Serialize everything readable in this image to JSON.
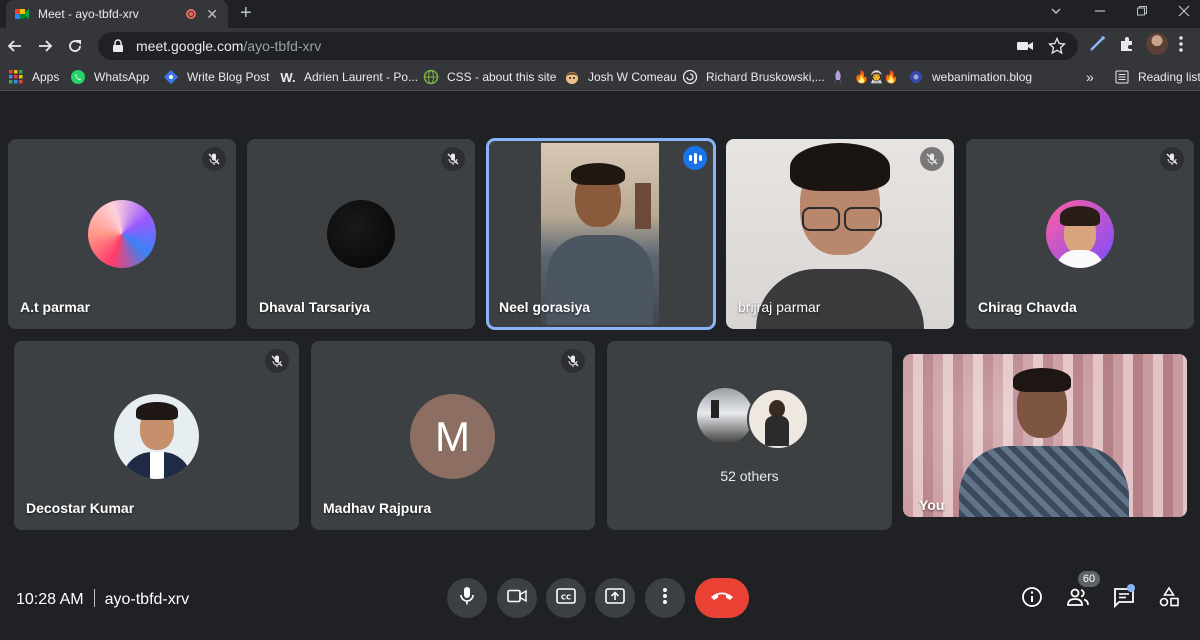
{
  "browser": {
    "tab_title": "Meet - ayo-tbfd-xrv",
    "url_host": "meet.google.com",
    "url_path": "/ayo-tbfd-xrv",
    "bookmarks": [
      {
        "label": "Apps",
        "icon": "apps-grid-icon"
      },
      {
        "label": "WhatsApp",
        "icon": "whatsapp-icon"
      },
      {
        "label": "Write Blog Post",
        "icon": "blog-icon"
      },
      {
        "label": "Adrien Laurent - Po...",
        "icon": "w-logo-icon"
      },
      {
        "label": "CSS - about this site",
        "icon": "css-globe-icon"
      },
      {
        "label": "Josh W Comeau",
        "icon": "josh-avatar-icon"
      },
      {
        "label": "Richard Bruskowski,...",
        "icon": "spiral-icon"
      },
      {
        "label": "🔥👨‍🚀🔥",
        "icon": "rocket-icon"
      },
      {
        "label": "webanimation.blog",
        "icon": "webanimation-icon"
      }
    ],
    "more_bookmarks": "»",
    "reading_list": "Reading list"
  },
  "meet": {
    "participants_row1": [
      {
        "name": "A.t parmar",
        "status": "muted"
      },
      {
        "name": "Dhaval Tarsariya",
        "status": "muted"
      },
      {
        "name": "Neel gorasiya",
        "status": "speaking"
      },
      {
        "name": "brijraj parmar",
        "status": "muted"
      },
      {
        "name": "Chirag Chavda",
        "status": "muted"
      }
    ],
    "participants_row2": [
      {
        "name": "Decostar Kumar",
        "status": "muted"
      },
      {
        "name": "Madhav Rajpura",
        "status": "muted",
        "initial": "M"
      },
      {
        "name": "52 others"
      },
      {
        "name": "You"
      }
    ]
  },
  "bottom_bar": {
    "time": "10:28 AM",
    "meeting_code": "ayo-tbfd-xrv",
    "participant_count": "60"
  },
  "colors": {
    "background": "#202124",
    "tile": "#3c4043",
    "speaking": "#1a73e8",
    "end_call": "#ea4335",
    "active_border": "#8ab4f8"
  }
}
